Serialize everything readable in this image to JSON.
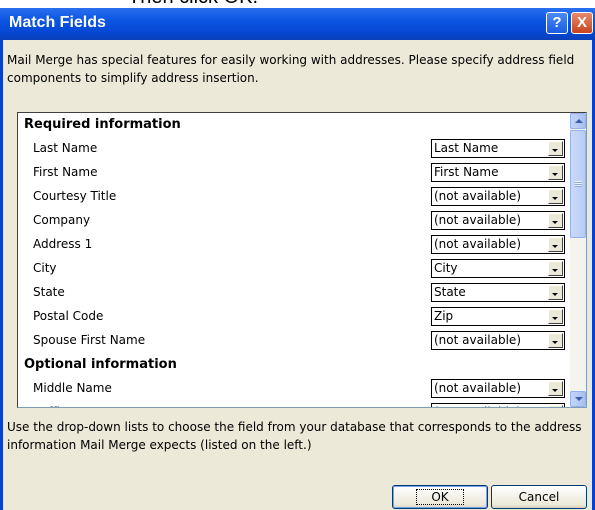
{
  "caption": "Then click OK.",
  "window": {
    "title": "Match Fields",
    "help_label": "?",
    "close_label": "X"
  },
  "intro_text": "Mail Merge has special features for easily working with addresses.  Please specify address field components to simplify address insertion.",
  "list": {
    "sections": [
      {
        "heading": "Required information",
        "rows": [
          {
            "label": "Last Name",
            "value": "Last Name"
          },
          {
            "label": "First Name",
            "value": "First Name"
          },
          {
            "label": "Courtesy Title",
            "value": "(not available)"
          },
          {
            "label": "Company",
            "value": "(not available)"
          },
          {
            "label": "Address 1",
            "value": "(not available)"
          },
          {
            "label": "City",
            "value": "City"
          },
          {
            "label": "State",
            "value": "State"
          },
          {
            "label": "Postal Code",
            "value": "Zip"
          },
          {
            "label": "Spouse First Name",
            "value": "(not available)"
          }
        ]
      },
      {
        "heading": "Optional information",
        "rows": [
          {
            "label": "Middle Name",
            "value": "(not available)"
          },
          {
            "label": "Suffix",
            "value": "(not available)"
          }
        ]
      }
    ]
  },
  "footer_text": "Use the drop-down lists to choose the field from your database that corresponds to the address information Mail Merge expects (listed on the left.)",
  "buttons": {
    "ok": "OK",
    "cancel": "Cancel"
  },
  "colors": {
    "titlebar": "#0a54e2",
    "dialog_bg": "#ece9d8"
  }
}
